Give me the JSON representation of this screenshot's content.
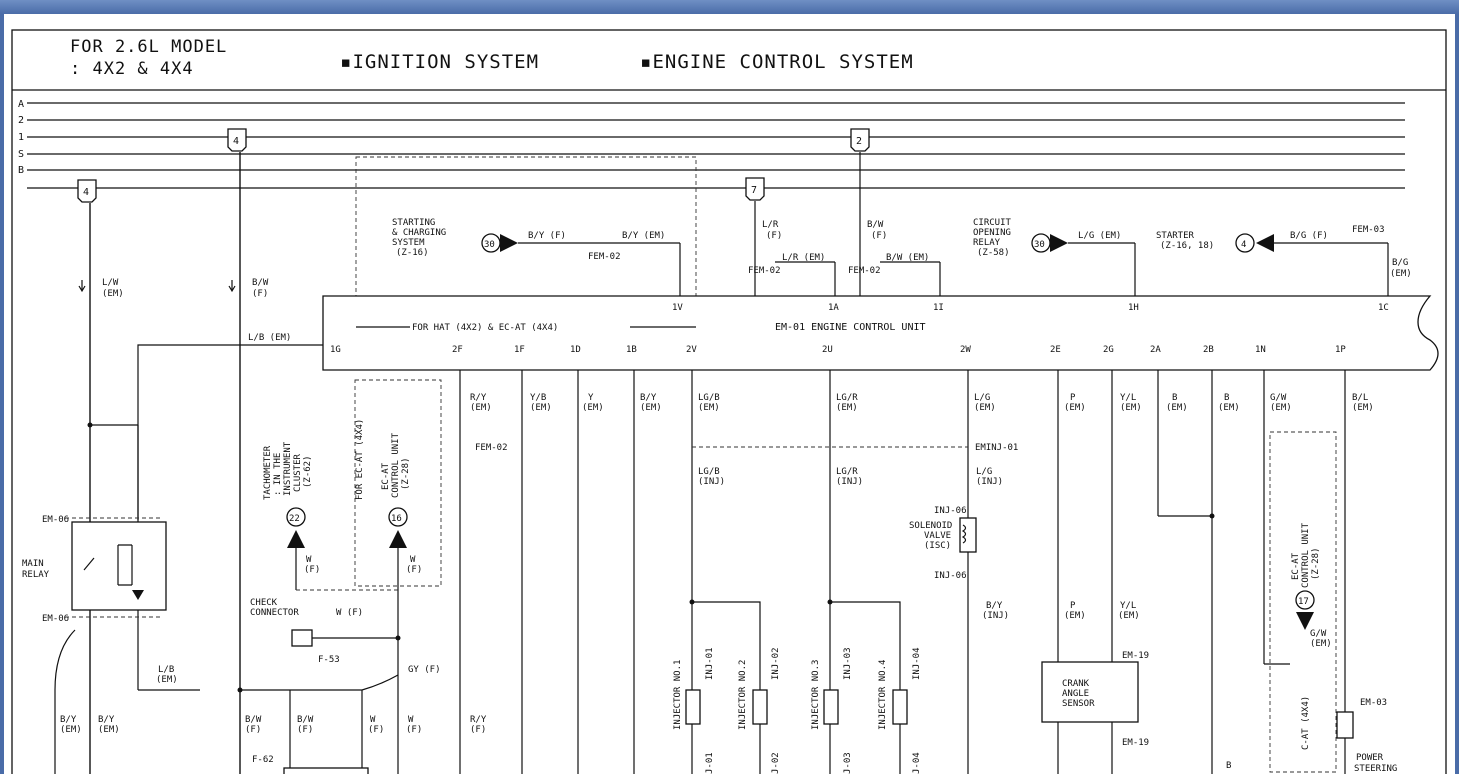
{
  "header": {
    "model_line1": "FOR 2.6L MODEL",
    "model_line2": ": 4X2 & 4X4",
    "system1": "▪IGNITION SYSTEM",
    "system2": "▪ENGINE CONTROL SYSTEM"
  },
  "rails": [
    "A",
    "2",
    "1",
    "S",
    "B"
  ],
  "fuse_tags": [
    "4",
    "4",
    "7",
    "2"
  ],
  "ecu": {
    "title": "EM-01 ENGINE CONTROL UNIT",
    "note": "FOR HAT (4X2) & EC-AT (4X4)",
    "top_pins": [
      "1V",
      "1A",
      "1I",
      "1H",
      "1C"
    ],
    "bottom_pins": [
      "1G",
      "2F",
      "1F",
      "1D",
      "1B",
      "2V",
      "2U",
      "2W",
      "2E",
      "2G",
      "2A",
      "2B",
      "1N",
      "1P"
    ]
  },
  "upper_blocks": [
    {
      "label": [
        "STARTING",
        "& CHARGING",
        "SYSTEM",
        "(Z-16)"
      ],
      "ref": "30",
      "wire1": "B/Y (F)",
      "wire2": "B/Y (EM)",
      "conn": "FEM-02"
    },
    {
      "label": [
        "CIRCUIT",
        "OPENING",
        "RELAY",
        "(Z-58)"
      ],
      "ref": "30",
      "wire": "L/G (EM)"
    },
    {
      "label": [
        "STARTER",
        "(Z-16, 18)"
      ],
      "ref": "4",
      "wire": "B/G (F)",
      "conn": "FEM-03",
      "wire2": [
        "B/G",
        "(EM)"
      ]
    }
  ],
  "upper_wires": [
    {
      "lines": [
        "L/R",
        "(F)"
      ]
    },
    {
      "lines": [
        "L/R (EM)"
      ]
    },
    {
      "lines": [
        "B/W",
        "(F)"
      ]
    },
    {
      "lines": [
        "B/W (EM)"
      ]
    },
    {
      "lines": [
        "FEM-02"
      ]
    },
    {
      "lines": [
        "FEM-02"
      ]
    }
  ],
  "left_wires": [
    {
      "lines": [
        "L/W",
        "(EM)"
      ]
    },
    {
      "lines": [
        "B/W",
        "(F)"
      ]
    },
    {
      "lines": [
        "L/B (EM)"
      ]
    }
  ],
  "bottom_wires": [
    [
      "R/Y",
      "(EM)"
    ],
    [
      "Y/B",
      "(EM)"
    ],
    [
      "Y",
      "(EM)"
    ],
    [
      "B/Y",
      "(EM)"
    ],
    [
      "LG/B",
      "(EM)"
    ],
    [
      "LG/R",
      "(EM)"
    ],
    [
      "L/G",
      "(EM)"
    ],
    [
      "P",
      "(EM)"
    ],
    [
      "Y/L",
      "(EM)"
    ],
    [
      "B",
      "(EM)"
    ],
    [
      "B",
      "(EM)"
    ],
    [
      "G/W",
      "(EM)"
    ],
    [
      "B/L",
      "(EM)"
    ]
  ],
  "inj_wires": [
    [
      "LG/B",
      "(INJ)"
    ],
    [
      "LG/R",
      "(INJ)"
    ],
    [
      "L/G",
      "(INJ)"
    ]
  ],
  "connectors": {
    "fem02": "FEM-02",
    "eminj01": "EMINJ-01",
    "em06": "EM-06",
    "f53": "F-53",
    "f62": "F-62",
    "inj06": "INJ-06",
    "em19": "EM-19",
    "em03": "EM-03"
  },
  "components": {
    "main_relay": [
      "MAIN",
      "RELAY"
    ],
    "tachometer": [
      "TACHOMETER",
      ": IN THE",
      "INSTRUMENT",
      "CLUSTER",
      "(Z-62)"
    ],
    "tacho_ref": "22",
    "ecat_note": "FOR EC-AT (4X4)",
    "ecat_unit": [
      "EC-AT",
      "CONTROL UNIT",
      "(Z-28)"
    ],
    "ecat_ref": "16",
    "check_connector": [
      "CHECK",
      "CONNECTOR"
    ],
    "solenoid": [
      "SOLENOID",
      "VALVE",
      "(ISC)"
    ],
    "crank": [
      "CRANK",
      "ANGLE",
      "SENSOR"
    ],
    "ecat_unit2": [
      "EC-AT",
      "CONTROL UNIT",
      "(Z-28)"
    ],
    "ecat_ref2": "17",
    "power_steering": [
      "POWER",
      "STEERING"
    ],
    "ecat_note2": "C-AT (4X4)",
    "injectors": [
      "INJECTOR NO.1",
      "INJECTOR NO.2",
      "INJECTOR NO.3",
      "INJECTOR NO.4"
    ],
    "inj_conns": [
      "INJ-01",
      "INJ-02",
      "INJ-03",
      "INJ-04"
    ],
    "inj_conns_low": [
      "J-01",
      "J-02",
      "J-03",
      "J-04"
    ]
  },
  "misc_labels": {
    "w_f": [
      "W",
      "(F)"
    ],
    "w_f_conn": "W (F)",
    "gy_f": "GY (F)",
    "lb_em": [
      "L/B",
      "(EM)"
    ],
    "by_em": [
      "B/Y",
      "(EM)"
    ],
    "bw_f": [
      "B/W",
      "(F)"
    ],
    "w_f_low": [
      "W",
      "(F)"
    ],
    "ry_f": [
      "R/Y",
      "(F)"
    ],
    "by_inj": [
      "B/Y",
      "(INJ)"
    ],
    "p_em": [
      "P",
      "(EM)"
    ],
    "yl_em": [
      "Y/L",
      "(EM)"
    ],
    "gw_em": [
      "G/W",
      "(EM)"
    ],
    "b_low": "B"
  }
}
